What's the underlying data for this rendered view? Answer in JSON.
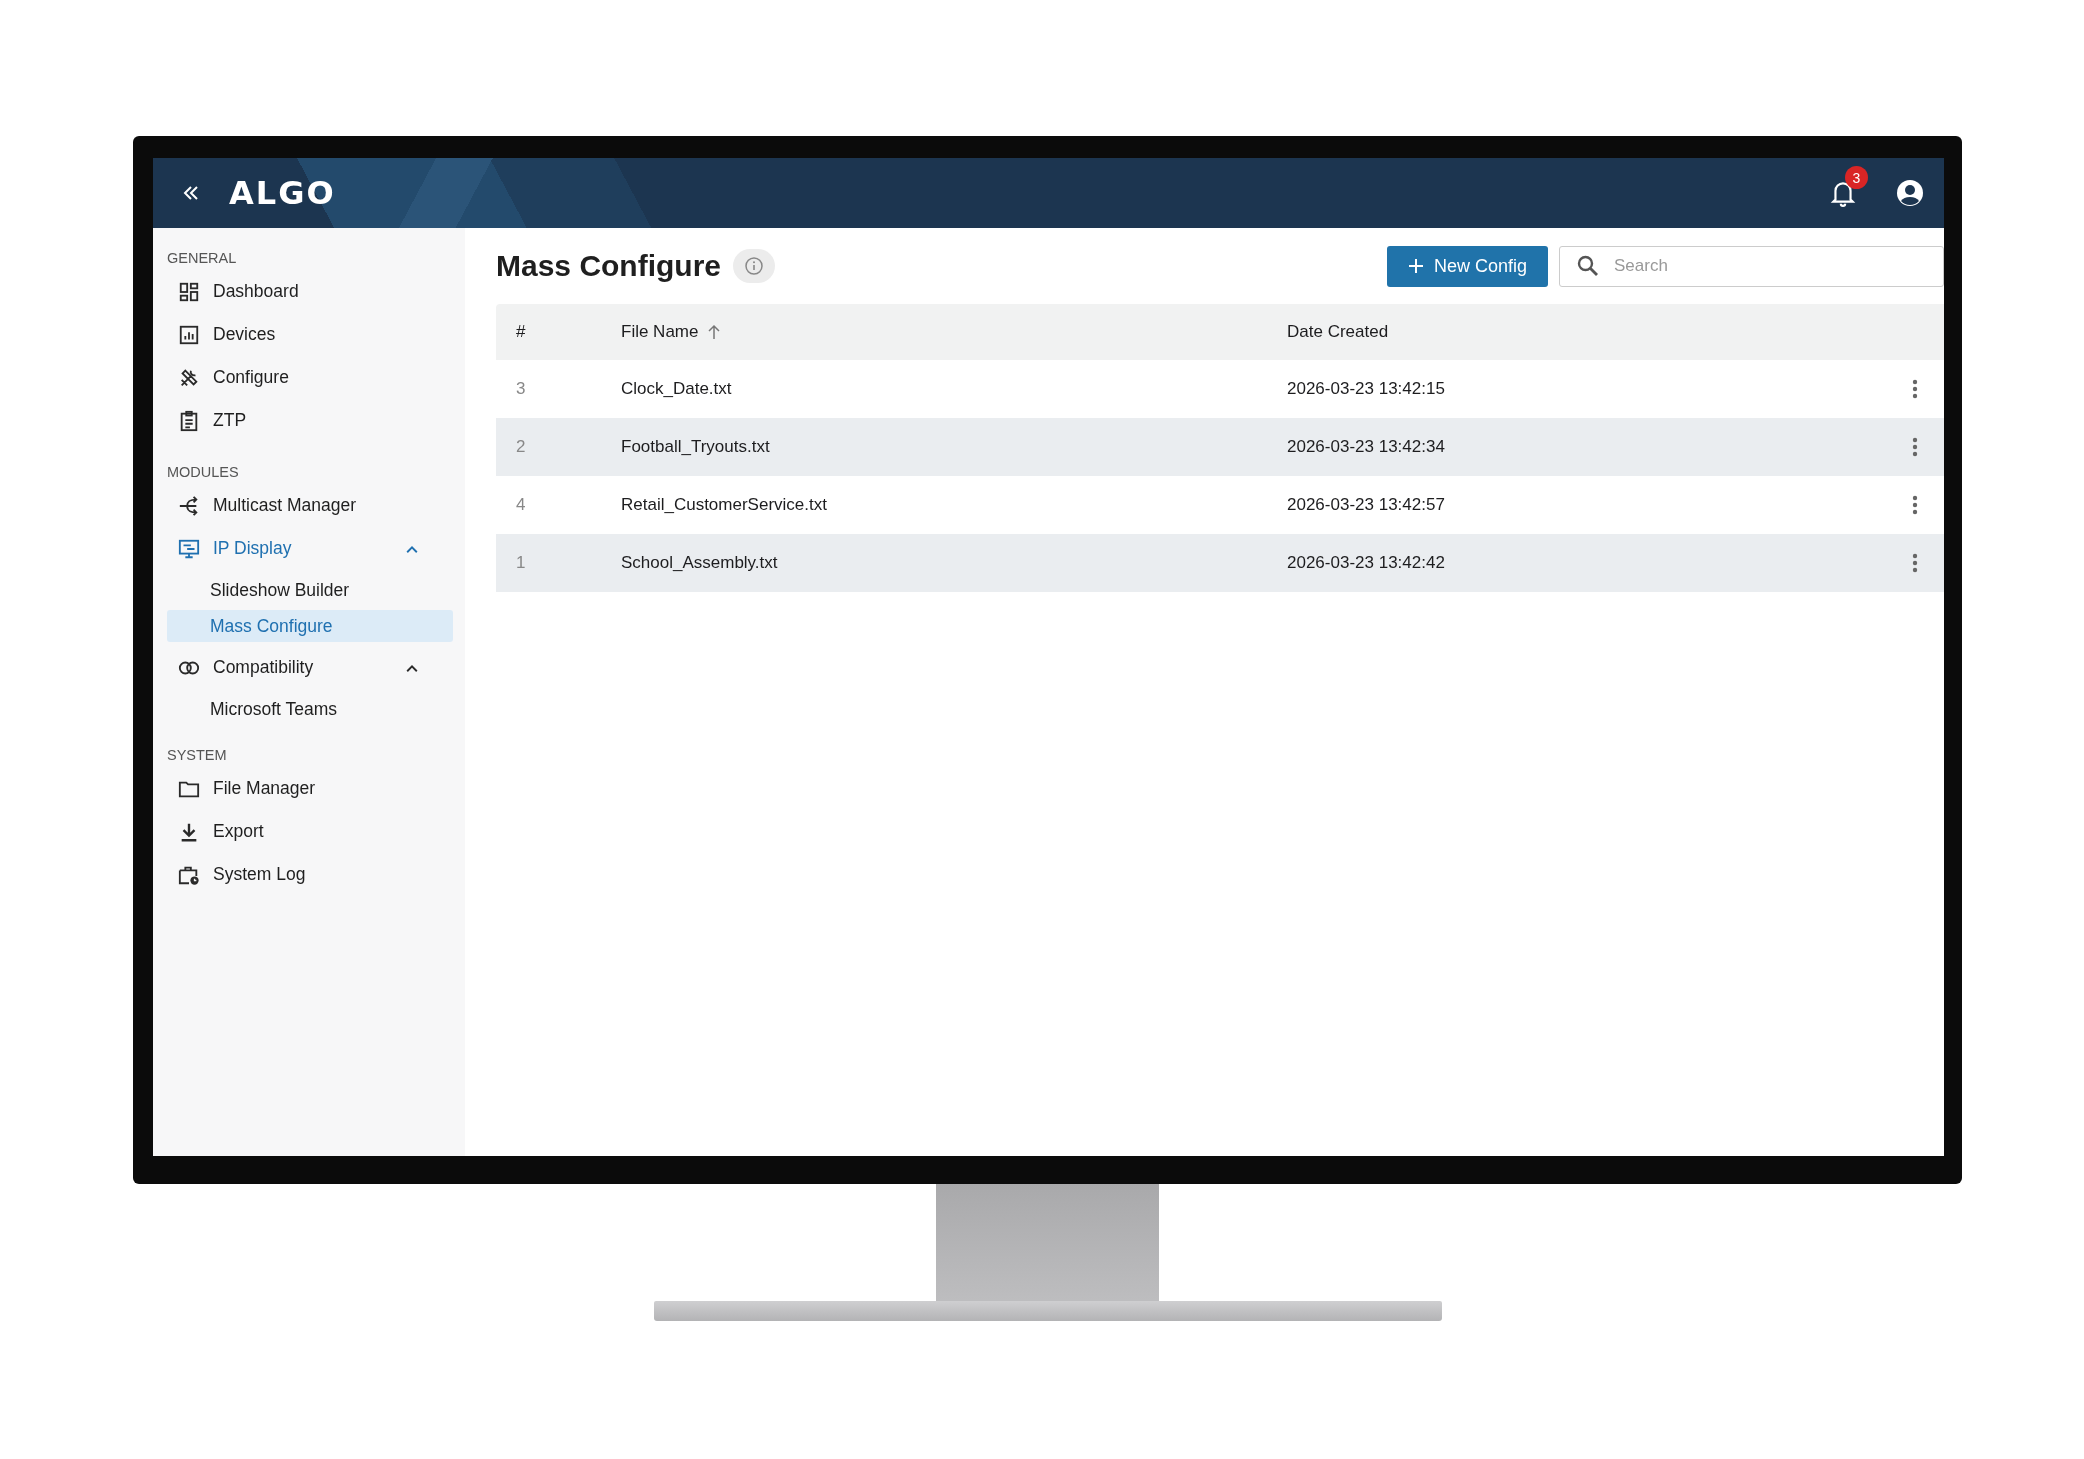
{
  "header": {
    "logo": "ALGO",
    "notification_count": "3"
  },
  "sidebar": {
    "sections": [
      {
        "heading": "GENERAL",
        "items": [
          {
            "label": "Dashboard",
            "active": false
          },
          {
            "label": "Devices",
            "active": false
          },
          {
            "label": "Configure",
            "active": false
          },
          {
            "label": "ZTP",
            "active": false
          }
        ]
      },
      {
        "heading": "MODULES",
        "items": [
          {
            "label": "Multicast Manager",
            "active": false
          },
          {
            "label": "IP Display",
            "active": true,
            "expanded": true,
            "children": [
              {
                "label": "Slideshow Builder",
                "selected": false
              },
              {
                "label": "Mass Configure",
                "selected": true
              }
            ]
          },
          {
            "label": "Compatibility",
            "active": false,
            "expanded": true,
            "children": [
              {
                "label": "Microsoft Teams",
                "selected": false
              }
            ]
          }
        ]
      },
      {
        "heading": "SYSTEM",
        "items": [
          {
            "label": "File Manager",
            "active": false
          },
          {
            "label": "Export",
            "active": false
          },
          {
            "label": "System Log",
            "active": false
          }
        ]
      }
    ]
  },
  "page": {
    "title": "Mass Configure",
    "new_button": "New Config",
    "search": {
      "placeholder": "Search"
    }
  },
  "table": {
    "columns": [
      {
        "label": "#",
        "sorted": false
      },
      {
        "label": "File Name",
        "sorted": true
      },
      {
        "label": "Date Created",
        "sorted": false
      }
    ],
    "rows": [
      {
        "number": "3",
        "file_name": "Clock_Date.txt",
        "date_created": "2026-03-23 13:42:15"
      },
      {
        "number": "2",
        "file_name": "Football_Tryouts.txt",
        "date_created": "2026-03-23 13:42:34"
      },
      {
        "number": "4",
        "file_name": "Retail_CustomerService.txt",
        "date_created": "2026-03-23 13:42:57"
      },
      {
        "number": "1",
        "file_name": "School_Assembly.txt",
        "date_created": "2026-03-23 13:42:42"
      }
    ]
  }
}
